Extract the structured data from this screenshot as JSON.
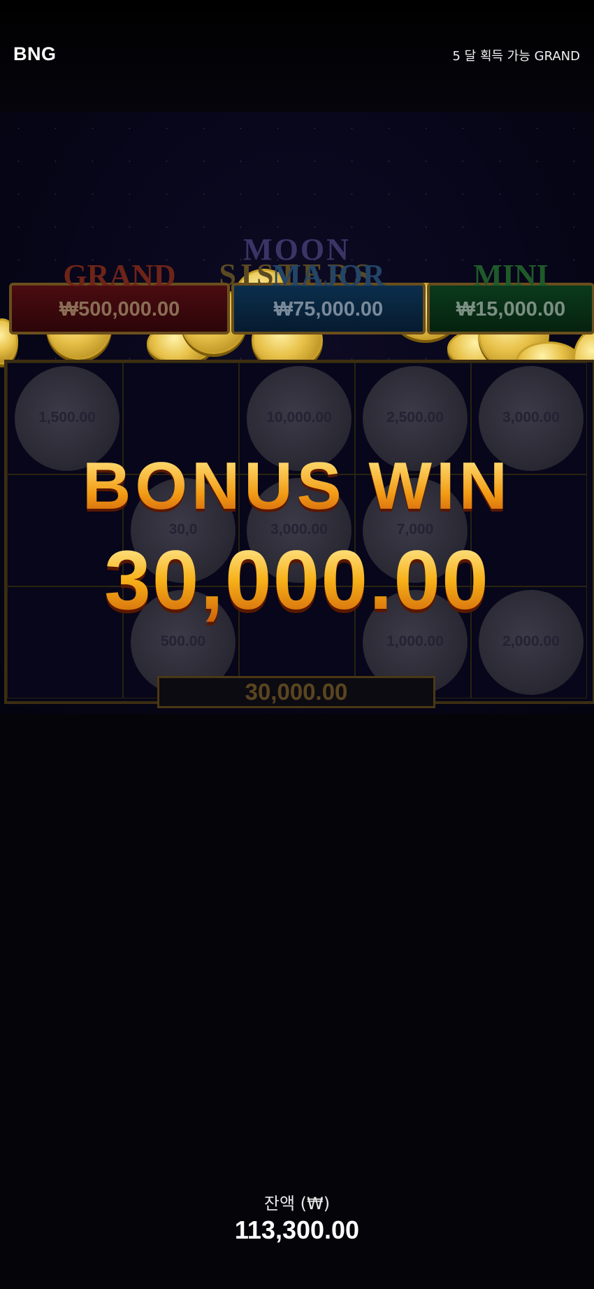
{
  "header": {
    "brand": "BNG",
    "grand_note": "5 달 획득 가능 GRAND"
  },
  "logo": {
    "line1": "MOON",
    "line2": "SISTERS"
  },
  "jackpots": [
    {
      "name": "GRAND",
      "amount": "₩500,000.00"
    },
    {
      "name": "MAJOR",
      "amount": "₩75,000.00"
    },
    {
      "name": "MINI",
      "amount": "₩15,000.00"
    }
  ],
  "grid": {
    "rows": [
      [
        "1,500.00",
        "",
        "10,000.00",
        "2,500.00",
        "3,000.00"
      ],
      [
        "",
        "30,0",
        "3,000.00",
        "7,000",
        ""
      ],
      [
        "",
        "500.00",
        "",
        "1,000.00",
        "2,000.00"
      ]
    ],
    "total": "30,000.00"
  },
  "bonus": {
    "label": "BONUS WIN",
    "amount": "30,000.00"
  },
  "footer": {
    "balance_label": "잔액 (₩)",
    "balance_value": "113,300.00"
  },
  "colors": {
    "gold": "#f7b11a",
    "background": "#050409"
  }
}
